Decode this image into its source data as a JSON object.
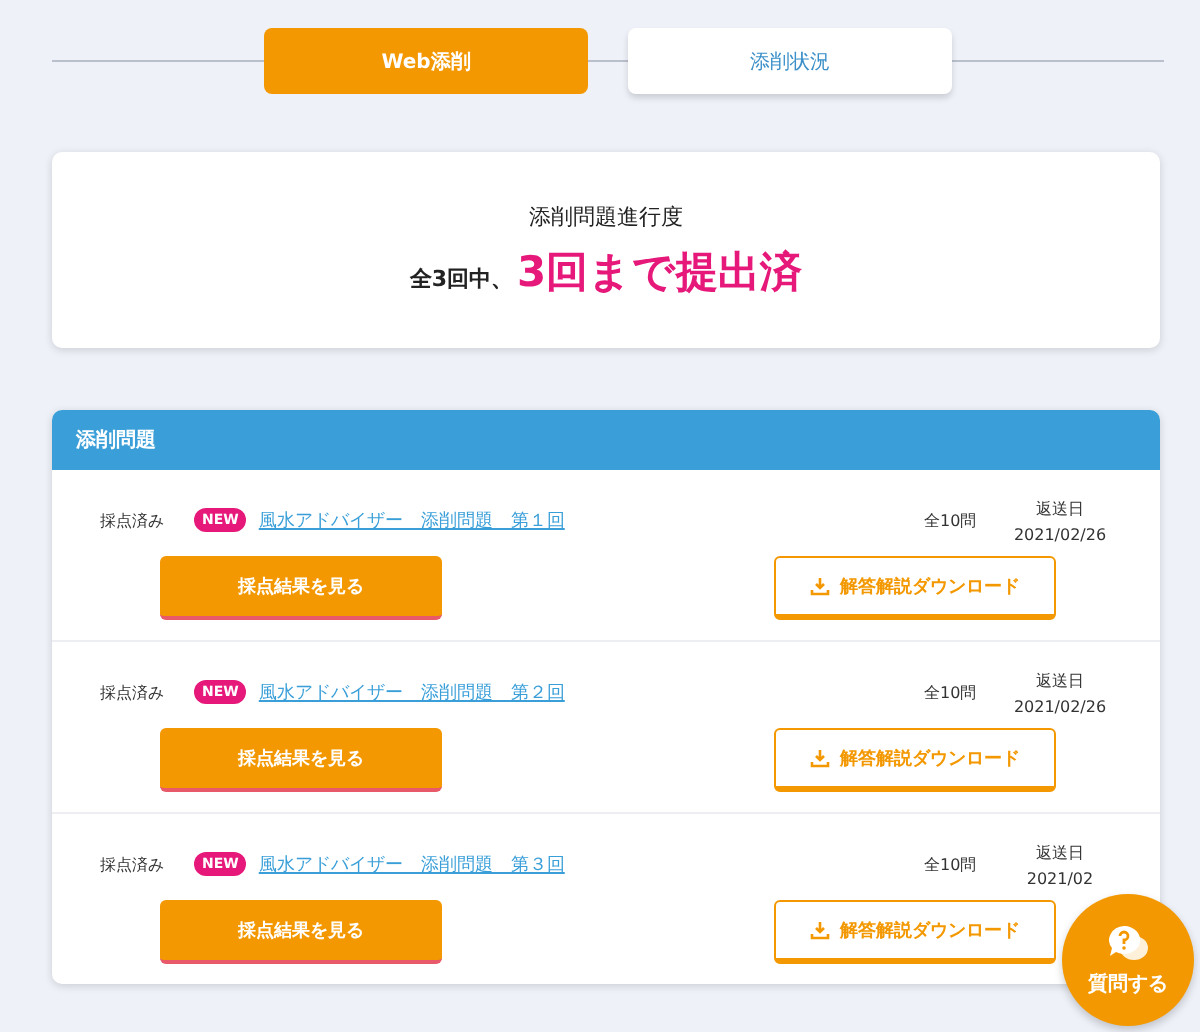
{
  "tabs": [
    {
      "label": "Web添削",
      "selected": true
    },
    {
      "label": "添削状況",
      "selected": false
    }
  ],
  "progress": {
    "title": "添削問題進行度",
    "prefix": "全3回中、",
    "highlight": "3回まで提出済"
  },
  "panel": {
    "title": "添削問題",
    "rows": [
      {
        "status": "採点済み",
        "badge": "NEW",
        "title": "風水アドバイザー　添削問題　第１回",
        "count": "全10問",
        "date_label": "返送日",
        "date": "2021/02/26",
        "result_button": "採点結果を見る",
        "download_button": "解答解説ダウンロード"
      },
      {
        "status": "採点済み",
        "badge": "NEW",
        "title": "風水アドバイザー　添削問題　第２回",
        "count": "全10問",
        "date_label": "返送日",
        "date": "2021/02/26",
        "result_button": "採点結果を見る",
        "download_button": "解答解説ダウンロード"
      },
      {
        "status": "採点済み",
        "badge": "NEW",
        "title": "風水アドバイザー　添削問題　第３回",
        "count": "全10問",
        "date_label": "返送日",
        "date": "2021/02",
        "result_button": "採点結果を見る",
        "download_button": "解答解説ダウンロード"
      }
    ]
  },
  "fab": {
    "label": "質問する"
  }
}
